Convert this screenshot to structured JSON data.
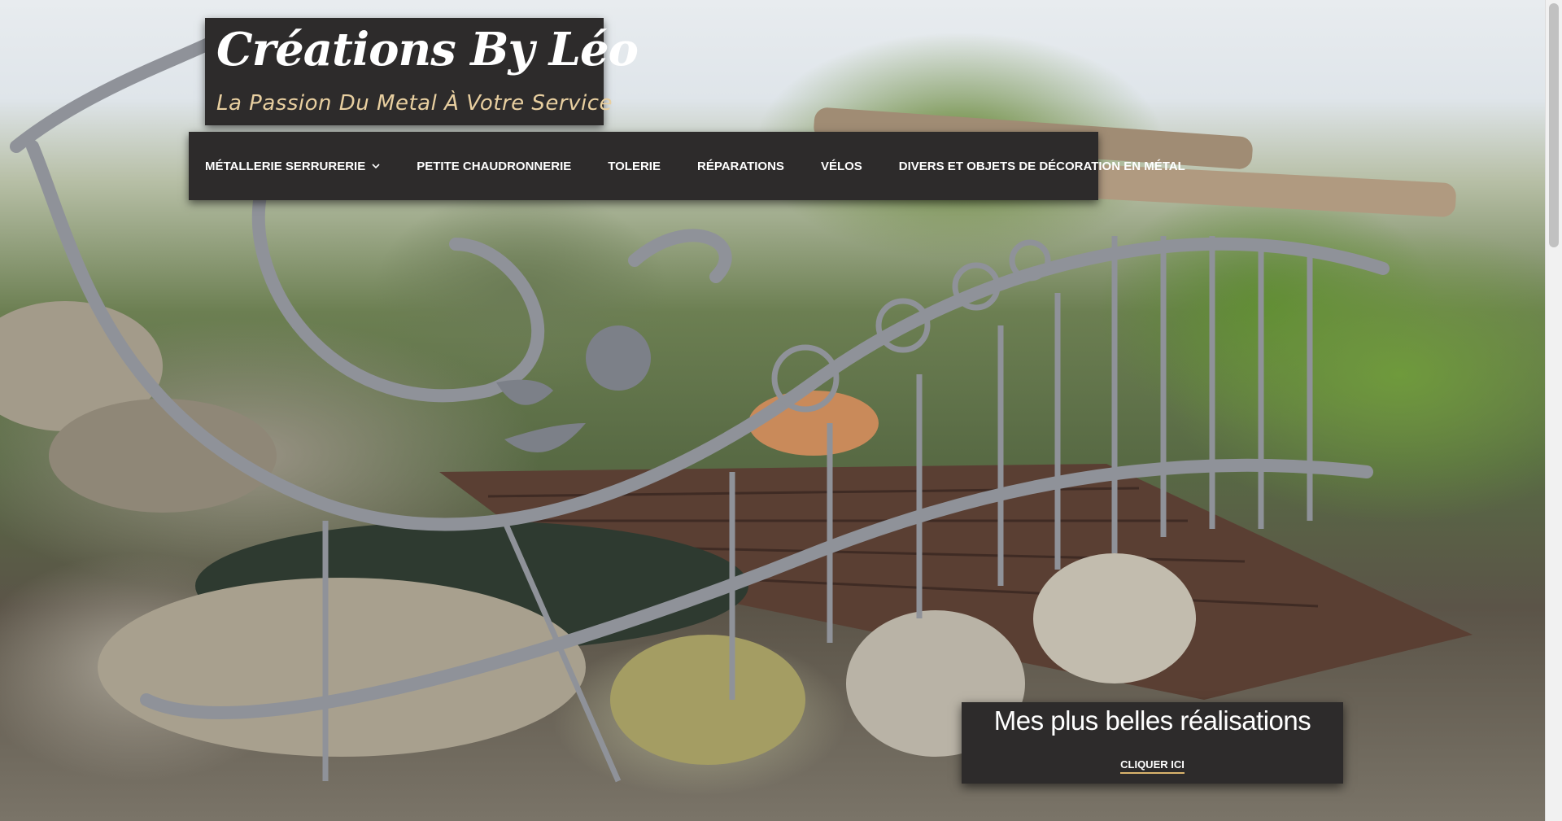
{
  "site": {
    "title": "Créations By Léo",
    "tagline": "La Passion Du Metal À Votre Service"
  },
  "nav": {
    "items": [
      {
        "label": "MÉTALLERIE SERRURERIE",
        "has_dropdown": true
      },
      {
        "label": "PETITE CHAUDRONNERIE"
      },
      {
        "label": "TOLERIE"
      },
      {
        "label": "RÉPARATIONS"
      },
      {
        "label": "VÉLOS"
      },
      {
        "label": "DIVERS ET OBJETS DE DÉCORATION EN MÉTAL"
      }
    ]
  },
  "cta": {
    "title": "Mes plus belles réalisations",
    "link_label": "CLIQUER ICI"
  },
  "colors": {
    "panel_bg": "#2d2b2b",
    "tagline": "#e8cfa0",
    "link_underline": "#d9b36c"
  }
}
